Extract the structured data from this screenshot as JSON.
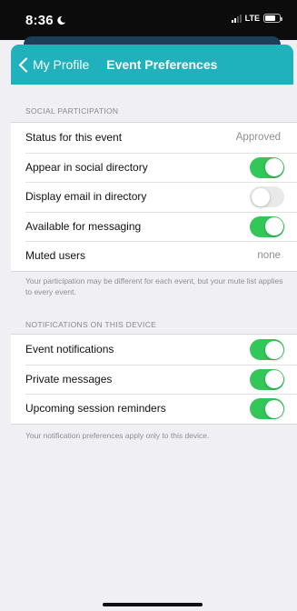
{
  "status_bar": {
    "time": "8:36",
    "network": "LTE",
    "battery_level": 0.7
  },
  "nav": {
    "back_label": "My Profile",
    "title": "Event Preferences"
  },
  "social": {
    "header": "SOCIAL PARTICIPATION",
    "rows": [
      {
        "label": "Status for this event",
        "value": "Approved"
      },
      {
        "label": "Appear in social directory",
        "toggle": true
      },
      {
        "label": "Display email in directory",
        "toggle": false
      },
      {
        "label": "Available for messaging",
        "toggle": true
      },
      {
        "label": "Muted users",
        "value": "none"
      }
    ],
    "footnote": "Your participation may be different for each event, but your mute list applies to every event."
  },
  "notifications": {
    "header": "NOTIFICATIONS ON THIS DEVICE",
    "rows": [
      {
        "label": "Event notifications",
        "toggle": true
      },
      {
        "label": "Private messages",
        "toggle": true
      },
      {
        "label": "Upcoming session reminders",
        "toggle": true
      }
    ],
    "footnote": "Your notification preferences apply only to this device."
  },
  "colors": {
    "accent": "#1fb2bd",
    "toggle_on": "#33c759",
    "toggle_off": "#e9e9eb"
  }
}
